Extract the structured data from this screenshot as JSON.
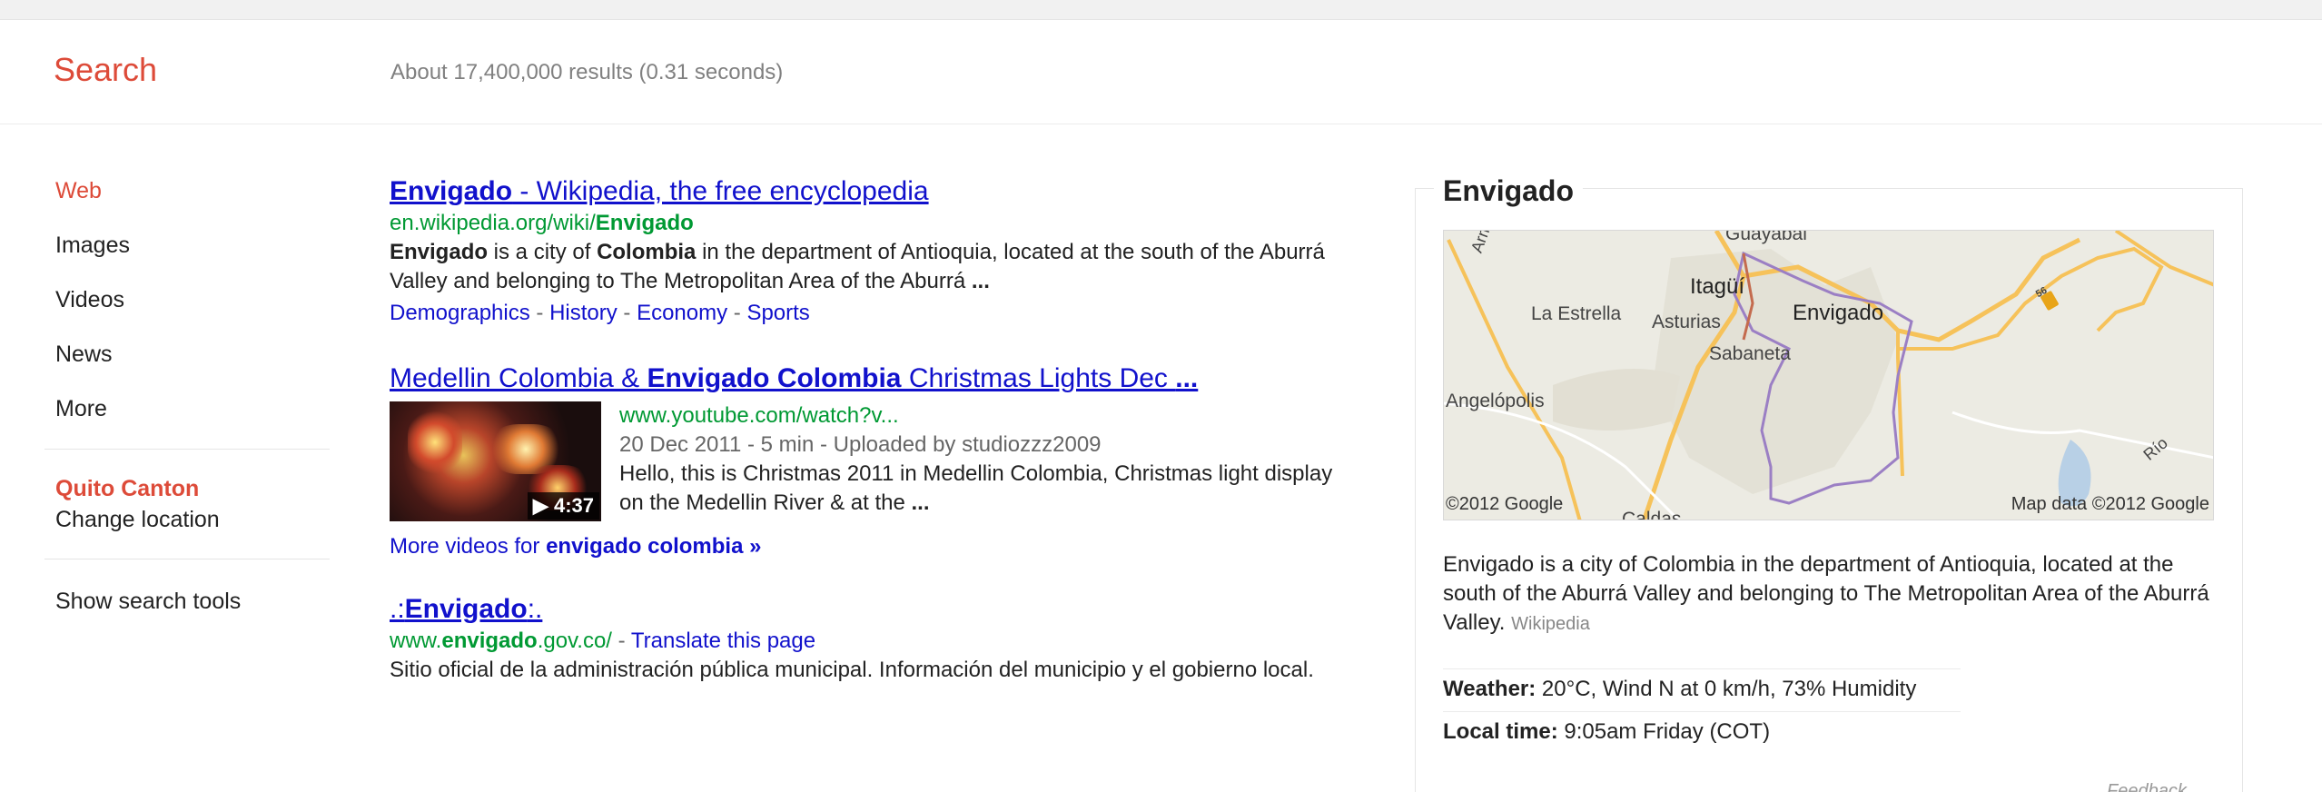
{
  "header": {
    "brand": "Search",
    "result_stats": "About 17,400,000 results (0.31 seconds)"
  },
  "nav": {
    "items": [
      {
        "label": "Web",
        "active": true
      },
      {
        "label": "Images"
      },
      {
        "label": "Videos"
      },
      {
        "label": "News"
      },
      {
        "label": "More"
      }
    ],
    "location_name": "Quito Canton",
    "change_location": "Change location",
    "search_tools": "Show search tools"
  },
  "results": [
    {
      "title_bold": "Envigado",
      "title_rest": " - Wikipedia, the free encyclopedia",
      "url_prefix": "en.wikipedia.org/wiki/",
      "url_bold": "Envigado",
      "snippet_b1": "Envigado",
      "snippet_t1": " is a city of ",
      "snippet_b2": "Colombia",
      "snippet_t2": " in the department of Antioquia, located at the south of the Aburrá Valley and belonging to The Metropolitan Area of the Aburrá ",
      "snippet_ell": "...",
      "sitelinks": [
        "Demographics",
        "History",
        "Economy",
        "Sports"
      ]
    },
    {
      "title_t1": "Medellin Colombia & ",
      "title_bold": "Envigado Colombia",
      "title_t2": " Christmas Lights Dec ",
      "title_ell": "...",
      "url": "www.youtube.com/watch?v...",
      "meta": "20 Dec 2011 - 5 min - Uploaded by studiozzz2009",
      "snippet": "Hello, this is Christmas 2011 in Medellin Colombia, Christmas light display on the Medellin River & at the ",
      "snippet_ell": "...",
      "duration": "▶ 4:37",
      "more_prefix": "More videos for ",
      "more_bold": "envigado colombia",
      "more_suffix": " »"
    },
    {
      "title_pre": ".:",
      "title_bold": "Envigado",
      "title_post": ":.",
      "url_prefix": "www.",
      "url_bold": "envigado",
      "url_suffix": ".gov.co/",
      "url_dash": " - ",
      "translate": "Translate this page",
      "snippet": "Sitio oficial de la administración pública municipal. Información del municipio y el gobierno local."
    }
  ],
  "knowledge_panel": {
    "title": "Envigado",
    "map": {
      "labels": [
        "Guayabal",
        "Itagüí",
        "Envigado",
        "La Estrella",
        "Asturias",
        "Sabaneta",
        "Angelópolis",
        "Caldas",
        "Armenia",
        "Río"
      ],
      "copyright_left": "©2012 Google",
      "copyright_right": "Map data ©2012 Google",
      "route_badge": "56"
    },
    "description": "Envigado is a city of Colombia in the department of Antioquia, located at the south of the Aburrá Valley and belonging to The Metropolitan Area of the Aburrá Valley.",
    "source": "Wikipedia",
    "weather_label": "Weather:",
    "weather_value": "20°C, Wind N at 0 km/h, 73% Humidity",
    "time_label": "Local time:",
    "time_value": "9:05am Friday (COT)",
    "feedback": "Feedback"
  }
}
